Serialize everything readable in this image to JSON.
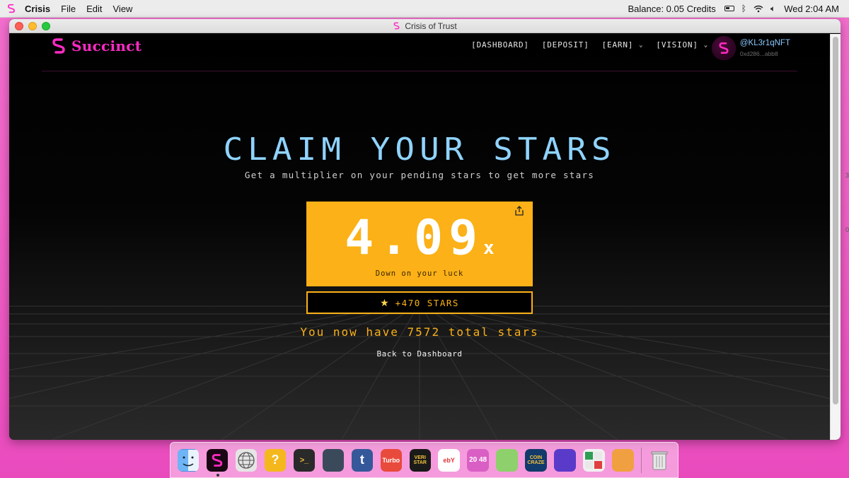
{
  "menubar": {
    "app_name": "Crisis",
    "menus": [
      "File",
      "Edit",
      "View"
    ],
    "balance": "Balance:  0.05 Credits",
    "clock": "Wed 2:04 AM"
  },
  "window": {
    "title": "Crisis of Trust"
  },
  "site": {
    "brand": "Succinct",
    "nav": [
      {
        "label": "[DASHBOARD]",
        "dropdown": false
      },
      {
        "label": "[DEPOSIT]",
        "dropdown": false
      },
      {
        "label": "[EARN]",
        "dropdown": true
      },
      {
        "label": "[VISION]",
        "dropdown": true
      }
    ],
    "user": {
      "handle": "@KL3r1qNFT",
      "address": "0xd286...abb8"
    }
  },
  "hero": {
    "title": "CLAIM YOUR STARS",
    "subtitle": "Get a multiplier on your pending stars to get more stars",
    "multiplier_value": "4.09",
    "multiplier_suffix": "x",
    "multiplier_caption": "Down on your luck",
    "stars_button_label": "+470 STARS",
    "total_stars": "You now have 7572 total stars",
    "back_link": "Back to Dashboard"
  },
  "side_peek": [
    "3",
    "0"
  ],
  "colors": {
    "brand_pink": "#ff2bc4",
    "title_blue": "#8fd3ff",
    "gold": "#fbb117",
    "desktop_pink": "#ef5fc6"
  },
  "dock": [
    {
      "name": "finder-icon",
      "text": "",
      "bg": "#4a90e2"
    },
    {
      "name": "succinct-app-icon",
      "text": "",
      "bg": "#1a0714"
    },
    {
      "name": "globe-icon",
      "text": "",
      "bg": "#e5e5e5"
    },
    {
      "name": "question-block-icon",
      "text": "?",
      "bg": "#f5b81c"
    },
    {
      "name": "terminal-icon",
      "text": ">_",
      "bg": "#2a2a2a"
    },
    {
      "name": "console-icon",
      "text": "",
      "bg": "#3b4a5a"
    },
    {
      "name": "tumblr-icon",
      "text": "t",
      "bg": "#35589a"
    },
    {
      "name": "turbo-icon",
      "text": "Turbo",
      "bg": "#e84a3c"
    },
    {
      "name": "veri-star-icon",
      "text": "VERI STAR",
      "bg": "#1a1a1a"
    },
    {
      "name": "ebay-icon",
      "text": "ebY",
      "bg": "#ffffff"
    },
    {
      "name": "game-2048-icon",
      "text": "20 48",
      "bg": "#d95fc4"
    },
    {
      "name": "monster-game-icon",
      "text": "",
      "bg": "#8ed06b"
    },
    {
      "name": "coin-craze-icon",
      "text": "COIN CRAZE",
      "bg": "#123a6b"
    },
    {
      "name": "character-game-icon",
      "text": "",
      "bg": "#5a3ac9"
    },
    {
      "name": "calculator-icon",
      "text": "",
      "bg": "#f0f0f0"
    },
    {
      "name": "cat-game-icon",
      "text": "",
      "bg": "#f0a040"
    },
    {
      "name": "trash-icon",
      "text": "",
      "bg": "transparent"
    }
  ]
}
